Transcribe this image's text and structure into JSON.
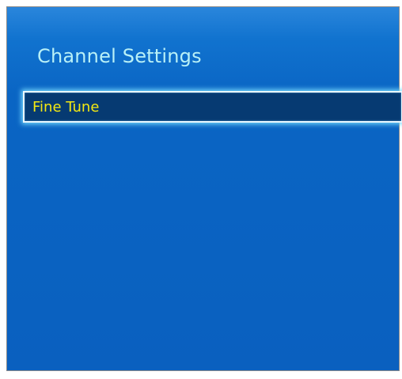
{
  "header": {
    "title": "Channel Settings"
  },
  "menu": {
    "items": [
      {
        "label": "Fine Tune",
        "selected": true
      }
    ]
  },
  "colors": {
    "panel_background": "#0a65c4",
    "title_text": "#b8f0f7",
    "selected_item_background": "#063a72",
    "selected_item_text": "#f4e812",
    "focus_border": "#eaf8ff"
  }
}
